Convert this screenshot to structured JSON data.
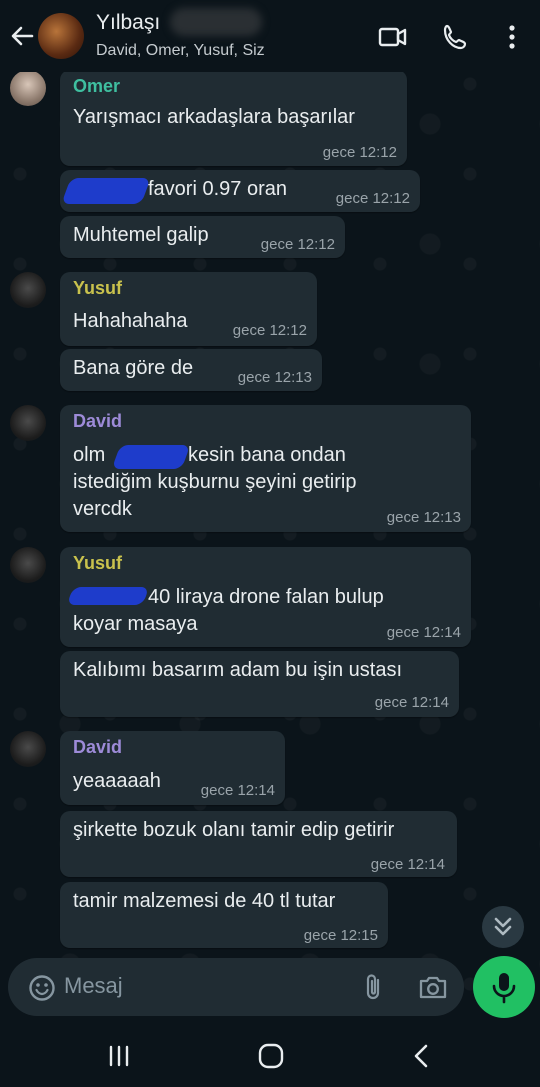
{
  "header": {
    "title": "Yılbaşı",
    "subtitle": "David, Omer, Yusuf, Siz"
  },
  "colors": {
    "omer": "#3fbfa0",
    "yusuf": "#c9c24d",
    "david": "#9d8bd8",
    "accent": "#21c063",
    "bubble": "#202c33"
  },
  "messages": [
    {
      "sender": "Omer",
      "text": "Yarışmacı arkadaşlara başarılar",
      "time": "gece 12:12"
    },
    {
      "text": "favori 0.97 oran",
      "time": "gece 12:12"
    },
    {
      "text": "Muhtemel galip",
      "time": "gece 12:12"
    },
    {
      "sender": "Yusuf",
      "text": "Hahahahaha",
      "time": "gece 12:12"
    },
    {
      "text": "Bana göre de",
      "time": "gece 12:13"
    },
    {
      "sender": "David",
      "line1a": "olm",
      "line1b": "kesin bana ondan",
      "line2": "istediğim kuşburnu şeyini getirip",
      "line3": "vercdk",
      "time": "gece 12:13"
    },
    {
      "sender": "Yusuf",
      "line1": "40 liraya drone falan bulup",
      "line2": "koyar masaya",
      "time": "gece 12:14"
    },
    {
      "text": "Kalıbımı basarım adam bu işin ustası",
      "time": "gece 12:14"
    },
    {
      "sender": "David",
      "text": "yeaaaaah",
      "time": "gece 12:14"
    },
    {
      "text": "şirkette bozuk olanı tamir edip getirir",
      "time": "gece 12:14"
    },
    {
      "text": "tamir malzemesi de 40 tl tutar",
      "time": "gece 12:15"
    }
  ],
  "input": {
    "placeholder": "Mesaj"
  },
  "icons": [
    "back-arrow-icon",
    "video-call-icon",
    "voice-call-icon",
    "more-options-icon",
    "scroll-down-icon",
    "emoji-icon",
    "attach-icon",
    "camera-icon",
    "mic-icon",
    "recents-icon",
    "home-icon",
    "nav-back-icon"
  ]
}
